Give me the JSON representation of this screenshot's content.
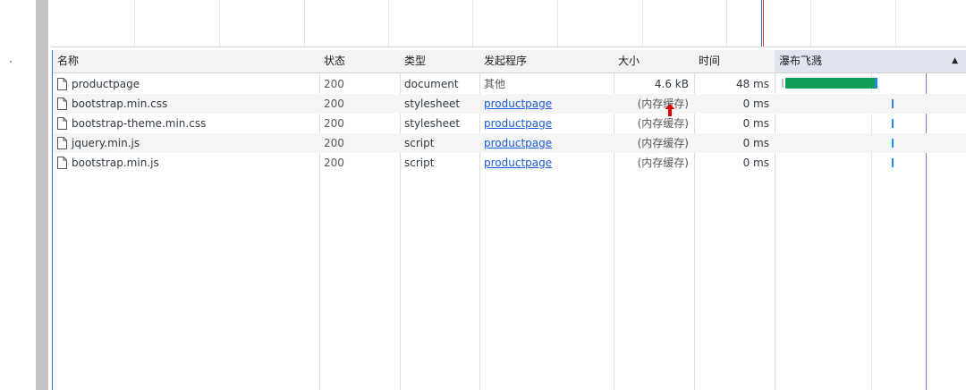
{
  "columns": {
    "name": "名称",
    "status": "状态",
    "type": "类型",
    "initiator": "发起程序",
    "size": "大小",
    "time": "时间",
    "waterfall": "瀑布飞溅",
    "sort_indicator": "▲"
  },
  "rows": [
    {
      "name": "productpage",
      "status": "200",
      "type": "document",
      "initiator": "其他",
      "initiator_is_link": false,
      "size": "4.6 kB",
      "time": "48 ms"
    },
    {
      "name": "bootstrap.min.css",
      "status": "200",
      "type": "stylesheet",
      "initiator": "productpage",
      "initiator_is_link": true,
      "size": "(内存缓存)",
      "time": "0 ms"
    },
    {
      "name": "bootstrap-theme.min.css",
      "status": "200",
      "type": "stylesheet",
      "initiator": "productpage",
      "initiator_is_link": true,
      "size": "(内存缓存)",
      "time": "0 ms"
    },
    {
      "name": "jquery.min.js",
      "status": "200",
      "type": "script",
      "initiator": "productpage",
      "initiator_is_link": true,
      "size": "(内存缓存)",
      "time": "0 ms"
    },
    {
      "name": "bootstrap.min.js",
      "status": "200",
      "type": "script",
      "initiator": "productpage",
      "initiator_is_link": true,
      "size": "(内存缓存)",
      "time": "0 ms"
    }
  ],
  "icons": {
    "file": "file-icon",
    "cursor": "red-arrow-cursor-icon",
    "sort": "sort-ascending-icon"
  },
  "colors": {
    "waterfall_download": "#0f9d58",
    "waterfall_waiting": "#1e8ce6",
    "link": "#1a5bd6",
    "cursor": "#e00000"
  }
}
